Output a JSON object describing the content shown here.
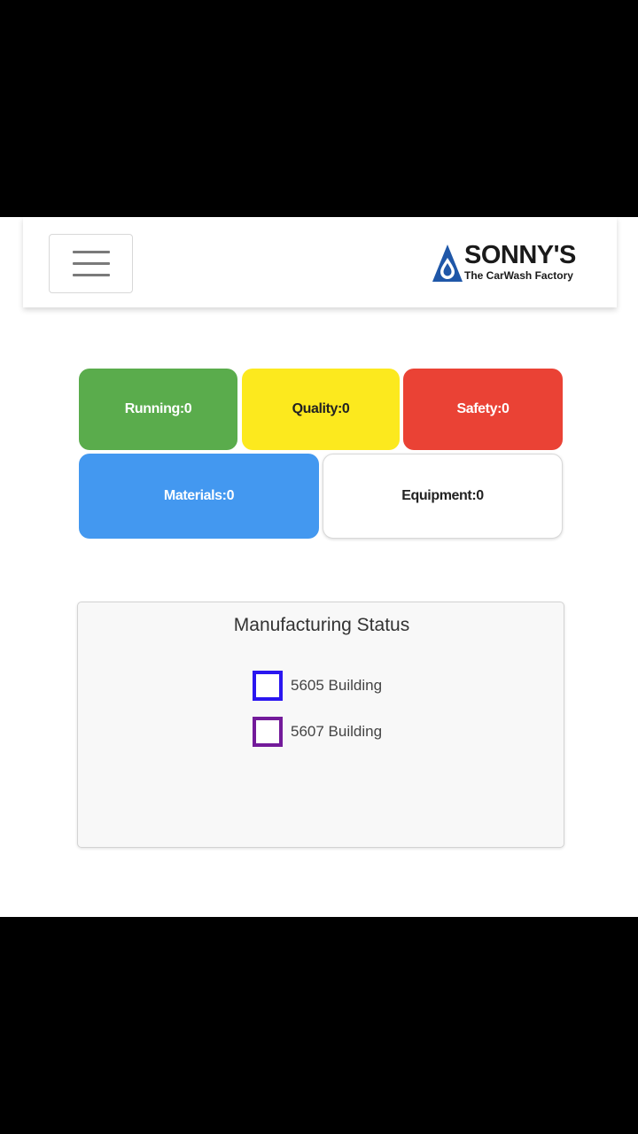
{
  "header": {
    "menu_icon": "hamburger-menu-icon",
    "logo": {
      "name": "SONNY'S",
      "tagline": "The CarWash Factory",
      "icon": "water-drop-logo-icon",
      "color": "#1f57a8"
    }
  },
  "tiles": [
    {
      "id": "running",
      "label": "Running:0",
      "color": "#5aac4c"
    },
    {
      "id": "quality",
      "label": "Quality:0",
      "color": "#fce91e"
    },
    {
      "id": "safety",
      "label": "Safety:0",
      "color": "#ea4235"
    },
    {
      "id": "materials",
      "label": "Materials:0",
      "color": "#4398f0"
    },
    {
      "id": "equipment",
      "label": "Equipment:0",
      "color": "#ffffff"
    }
  ],
  "status_panel": {
    "title": "Manufacturing Status",
    "legend": [
      {
        "label": "5605 Building",
        "color": "#2a16f0"
      },
      {
        "label": "5607 Building",
        "color": "#731a9a"
      }
    ]
  }
}
